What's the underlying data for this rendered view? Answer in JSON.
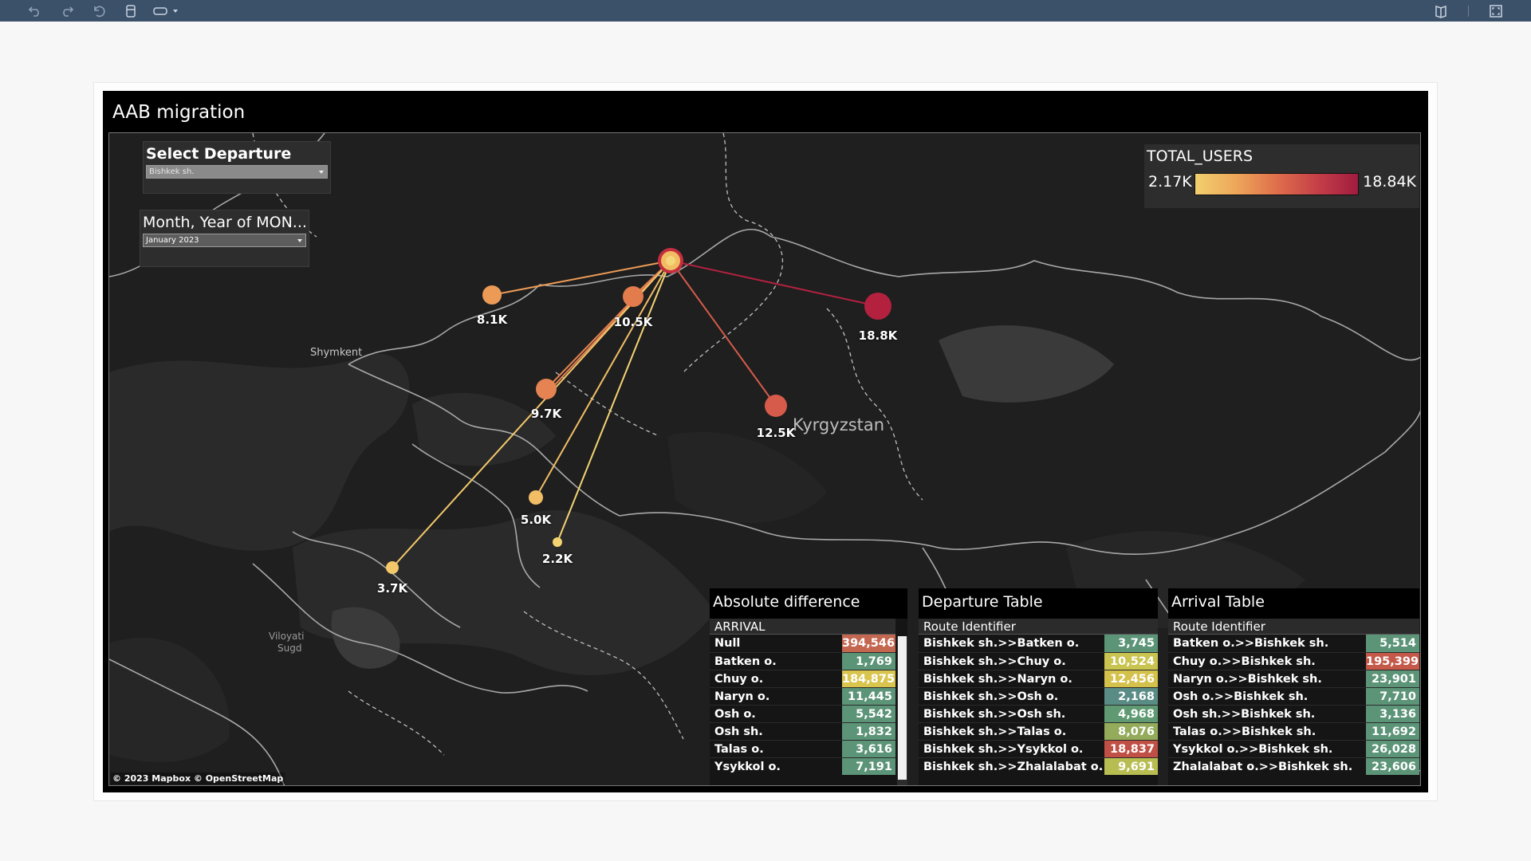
{
  "dashboard": {
    "title": "AAB migration"
  },
  "filters": {
    "departure": {
      "title": "Select Departure",
      "value": "Bishkek sh."
    },
    "month": {
      "title": "Month, Year of MON...",
      "value": "January 2023"
    }
  },
  "legend": {
    "title": "TOTAL_USERS",
    "min": "2.17K",
    "max": "18.84K",
    "ramp_colors": [
      "#f2cf6f",
      "#df6f4c",
      "#a01c3f"
    ]
  },
  "map_labels": {
    "country": "Kyrgyzstan",
    "city1": "Shymkent",
    "region1": "Viloyati",
    "region2": "Sugd",
    "attribution": "© 2023 Mapbox  © OpenStreetMap"
  },
  "bubbles": [
    {
      "label": "8.1K",
      "color": "#ec9b57"
    },
    {
      "label": "10.5K",
      "color": "#e37c4d"
    },
    {
      "label": "18.8K",
      "color": "#b3213f"
    },
    {
      "label": "9.7K",
      "color": "#e58352"
    },
    {
      "label": "12.5K",
      "color": "#d65b4b"
    },
    {
      "label": "5.0K",
      "color": "#f1be66"
    },
    {
      "label": "2.2K",
      "color": "#f4d472"
    },
    {
      "label": "3.7K",
      "color": "#f2c86a"
    }
  ],
  "tables": {
    "absolute_difference": {
      "title": "Absolute difference",
      "header": "ARRIVAL",
      "rows": [
        {
          "name": "Null",
          "value": "394,546",
          "color": "#c46750"
        },
        {
          "name": "Batken o.",
          "value": "1,769",
          "color": "#5c9478"
        },
        {
          "name": "Chuy o.",
          "value": "184,875",
          "color": "#d9c44e"
        },
        {
          "name": "Naryn o.",
          "value": "11,445",
          "color": "#5c9478"
        },
        {
          "name": "Osh o.",
          "value": "5,542",
          "color": "#5c9478"
        },
        {
          "name": "Osh sh.",
          "value": "1,832",
          "color": "#5c9478"
        },
        {
          "name": "Talas o.",
          "value": "3,616",
          "color": "#5c9478"
        },
        {
          "name": "Ysykkol o.",
          "value": "7,191",
          "color": "#5c9478"
        }
      ]
    },
    "departure": {
      "title": "Departure Table",
      "header": "Route Identifier",
      "rows": [
        {
          "name": "Bishkek sh.>>Batken o.",
          "value": "3,745",
          "color": "#5c9478"
        },
        {
          "name": "Bishkek sh.>>Chuy o.",
          "value": "10,524",
          "color": "#c9c34f"
        },
        {
          "name": "Bishkek sh.>>Naryn o.",
          "value": "12,456",
          "color": "#d4c14c"
        },
        {
          "name": "Bishkek sh.>>Osh o.",
          "value": "2,168",
          "color": "#5a8c86"
        },
        {
          "name": "Bishkek sh.>>Osh sh.",
          "value": "4,968",
          "color": "#5f9a72"
        },
        {
          "name": "Bishkek sh.>>Talas o.",
          "value": "8,076",
          "color": "#93ab5a"
        },
        {
          "name": "Bishkek sh.>>Ysykkol o.",
          "value": "18,837",
          "color": "#c04f45"
        },
        {
          "name": "Bishkek sh.>>Zhalalabat o.",
          "value": "9,691",
          "color": "#b8bd52"
        }
      ]
    },
    "arrival": {
      "title": "Arrival Table",
      "header": "Route Identifier",
      "rows": [
        {
          "name": "Batken o.>>Bishkek sh.",
          "value": "5,514",
          "color": "#5c9478"
        },
        {
          "name": "Chuy o.>>Bishkek sh.",
          "value": "195,399",
          "color": "#c4594a"
        },
        {
          "name": "Naryn o.>>Bishkek sh.",
          "value": "23,901",
          "color": "#5c9478"
        },
        {
          "name": "Osh o.>>Bishkek sh.",
          "value": "7,710",
          "color": "#5c9478"
        },
        {
          "name": "Osh sh.>>Bishkek sh.",
          "value": "3,136",
          "color": "#5c9478"
        },
        {
          "name": "Talas o.>>Bishkek sh.",
          "value": "11,692",
          "color": "#5c9478"
        },
        {
          "name": "Ysykkol o.>>Bishkek sh.",
          "value": "26,028",
          "color": "#5c9478"
        },
        {
          "name": "Zhalalabat o.>>Bishkek sh.",
          "value": "23,606",
          "color": "#5c9478"
        }
      ]
    }
  }
}
